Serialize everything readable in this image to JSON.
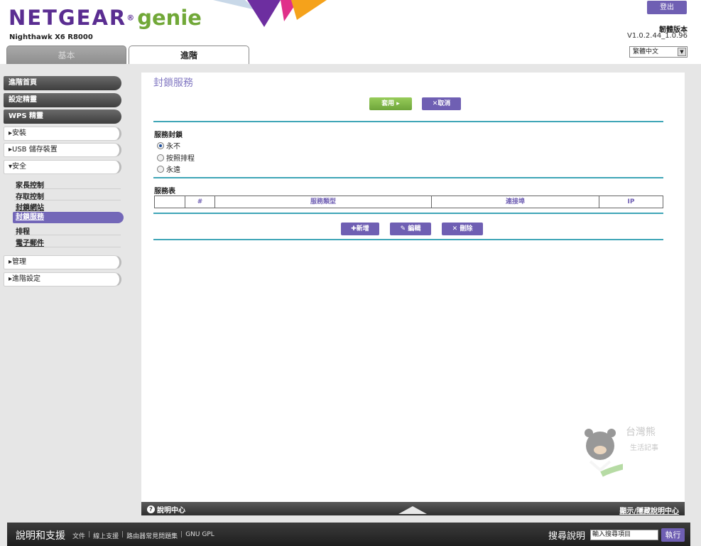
{
  "header": {
    "brand": "NETGEAR",
    "brand_reg": "®",
    "product": "genie",
    "model": "Nighthawk X6 R8000",
    "logout_label": "登出",
    "firmware_label": "韌體版本",
    "firmware_version": "V1.0.2.44_1.0.96",
    "language": "繁體中文",
    "tabs": [
      {
        "label": "基本",
        "active": false
      },
      {
        "label": "進階",
        "active": true
      }
    ]
  },
  "sidebar": {
    "top_items": [
      {
        "label": "進階首頁"
      },
      {
        "label": "設定精靈"
      },
      {
        "label": "WPS 精靈"
      }
    ],
    "sections": [
      {
        "label": "▸安裝"
      },
      {
        "label": "▸USB 儲存裝置"
      },
      {
        "label": "▾安全"
      }
    ],
    "security_items": [
      {
        "label": "家長控制"
      },
      {
        "label": "存取控制"
      },
      {
        "label": "封鎖網站"
      },
      {
        "label": "封鎖服務"
      },
      {
        "label": "排程"
      },
      {
        "label": "電子郵件"
      }
    ],
    "bottom_sections": [
      {
        "label": "▸管理"
      },
      {
        "label": "▸進階設定"
      }
    ]
  },
  "main": {
    "title": "封鎖服務",
    "apply_label": "套用 ▸",
    "cancel_label": "✕取消",
    "blocking": {
      "label": "服務封鎖",
      "options": [
        {
          "label": "永不",
          "checked": true
        },
        {
          "label": "按照排程",
          "checked": false
        },
        {
          "label": "永遠",
          "checked": false
        }
      ]
    },
    "table": {
      "label": "服務表",
      "columns": [
        "",
        "#",
        "服務類型",
        "連接埠",
        "IP"
      ]
    },
    "add_label": "✚新增",
    "edit_label": "✎ 編輯",
    "delete_label": "✕ 刪除",
    "watermark_text": "台灣熊",
    "watermark_sub": "生活記事"
  },
  "helpbar": {
    "help_center": "說明中心",
    "hide_help": "顯示/隱藏說明中心"
  },
  "footer": {
    "title": "說明和支援",
    "links": [
      "文件",
      "線上支援",
      "路由器常見問題集",
      "GNU GPL"
    ],
    "search_label": "搜尋說明",
    "search_placeholder": "輸入搜尋項目",
    "go_label": "執行"
  },
  "colors": {
    "brand_purple": "#5a2d91",
    "genie_green": "#71a838",
    "accent_purple": "#6f5fb3",
    "teal_rule": "#3fa6b7",
    "apply_green": "#7cb544"
  }
}
